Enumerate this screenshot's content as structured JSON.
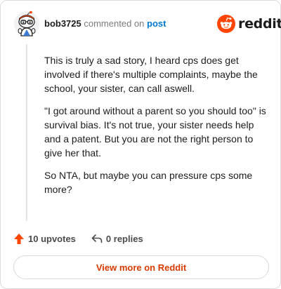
{
  "comment": {
    "username": "bob3725",
    "action_text": "commented on",
    "target_text": "post",
    "paragraphs": [
      "This is truly a sad story, I heard cps does get involved if there's multiple complaints, maybe the school, your sister, can call aswell.",
      "\"I got around without a parent so you should too\" is survival bias. It's not true, your sister needs help and a patent. But you are not the right person to give her that.",
      "So NTA, but maybe you can pressure cps some more?"
    ]
  },
  "brand": {
    "name": "reddit",
    "icon": "reddit-snoo-icon",
    "color": "#ff4500"
  },
  "actions": {
    "upvotes_label": "10 upvotes",
    "replies_label": "0 replies"
  },
  "footer": {
    "view_more_label": "View more on Reddit"
  },
  "colors": {
    "accent_orange": "#d93a00",
    "upvote_orange": "#ff4500",
    "link_blue": "#0079d3",
    "muted_text": "#7c7c7c"
  }
}
